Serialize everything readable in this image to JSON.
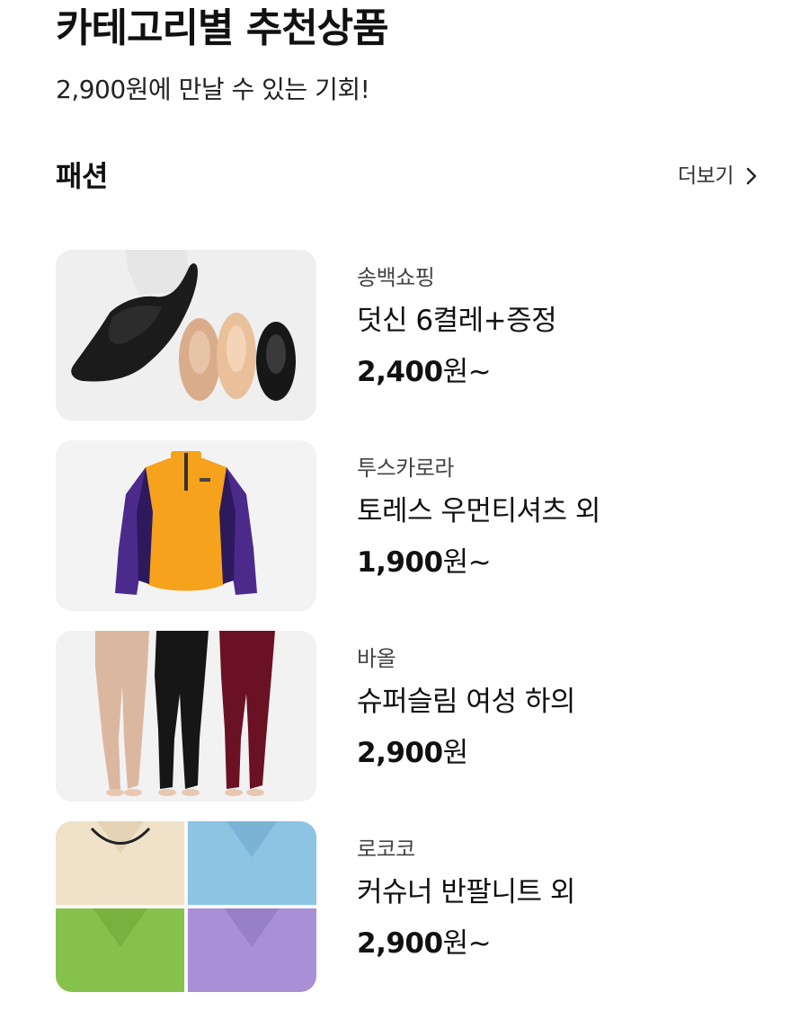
{
  "header": {
    "title": "카테고리별 추천상품",
    "subtitle": "2,900원에 만날 수 있는 기회!"
  },
  "section": {
    "title": "패션",
    "more_label": "더보기",
    "more_icon": "chevron-right-icon"
  },
  "products": [
    {
      "seller": "송백쇼핑",
      "name": "덧신 6켤레+증정",
      "price": "2,400",
      "price_suffix": "원~",
      "image": "socks-image"
    },
    {
      "seller": "투스카로라",
      "name": "토레스 우먼티셔츠 외",
      "price": "1,900",
      "price_suffix": "원~",
      "image": "sport-shirt-image"
    },
    {
      "seller": "바올",
      "name": "슈퍼슬림 여성 하의",
      "price": "2,900",
      "price_suffix": "원",
      "image": "leggings-image"
    },
    {
      "seller": "로코코",
      "name": "커슈너 반팔니트 외",
      "price": "2,900",
      "price_suffix": "원~",
      "image": "knit-tops-image"
    }
  ],
  "colors": {
    "text_primary": "#111111",
    "text_secondary": "#444444",
    "thumb_background": "#f2f2f2"
  }
}
